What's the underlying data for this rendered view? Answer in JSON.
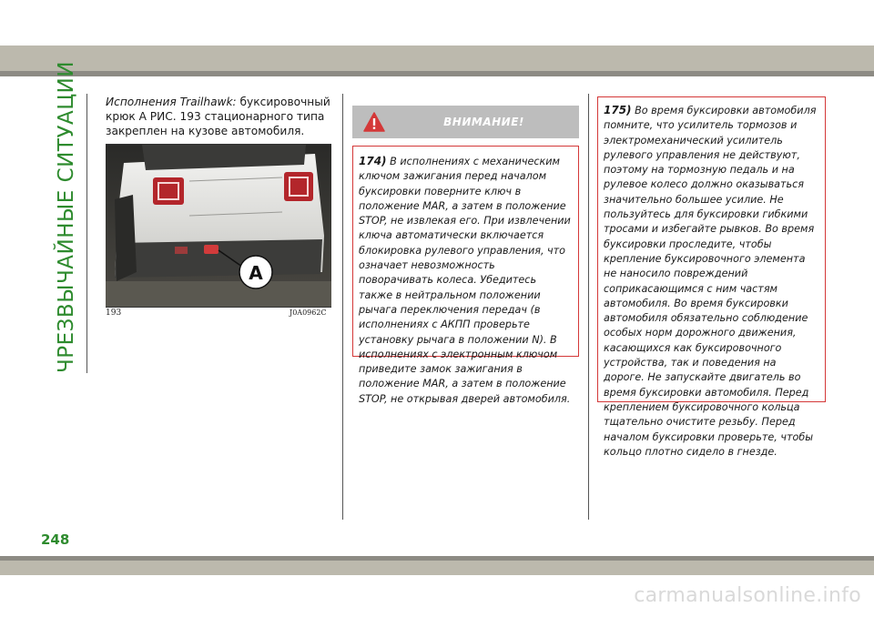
{
  "sidebar": {
    "section_title": "ЧРЕЗВЫЧАЙНЫЕ СИТУАЦИИ"
  },
  "intro": {
    "lead": "Исполнения Trailhawk:",
    "text": " буксировочный крюк А РИС. 193 стационарного типа закреплен на кузове автомобиля."
  },
  "figure": {
    "number": "193",
    "code": "J0A0962C",
    "callout": "A"
  },
  "warning": {
    "title": "ВНИМАНИЕ!",
    "note1_num": "174)",
    "note1_text": " В исполнениях с механическим ключом зажигания перед началом буксировки поверните ключ в положение MAR, а затем в положение STOP, не извлекая его. При извлечении ключа автоматически включается блокировка рулевого управления, что означает невозможность поворачивать колеса. Убедитесь также в нейтральном положении рычага переключения передач (в исполнениях с АКПП проверьте установку рычага в положении N). В исполнениях с электронным ключом приведите замок зажигания в положение MAR, а затем в положение STOP, не открывая дверей автомобиля.",
    "note2_num": "175)",
    "note2_text": " Во время буксировки автомобиля помните, что усилитель тормозов и электромеханический усилитель рулевого управления не действуют, поэтому на тормозную педаль и на рулевое колесо должно оказываться значительно большее усилие. Не пользуйтесь для буксировки гибкими тросами и избегайте рывков. Во время буксировки проследите, чтобы крепление буксировочного элемента не наносило повреждений соприкасающимся с ним частям автомобиля. Во время буксировки автомобиля обязательно соблюдение особых норм дорожного движения, касающихся как буксировочного устройства, так и поведения на дороге. Не запускайте двигатель во время буксировки автомобиля. Перед креплением буксировочного кольца тщательно очистите резьбу. Перед началом буксировки проверьте, чтобы кольцо плотно сидело в гнезде."
  },
  "footer": {
    "page_number": "248",
    "watermark": "carmanualsonline.info"
  },
  "colors": {
    "accent_green": "#2e8b2e",
    "warning_border": "#d43838",
    "band_gray": "#bcb9ad"
  }
}
